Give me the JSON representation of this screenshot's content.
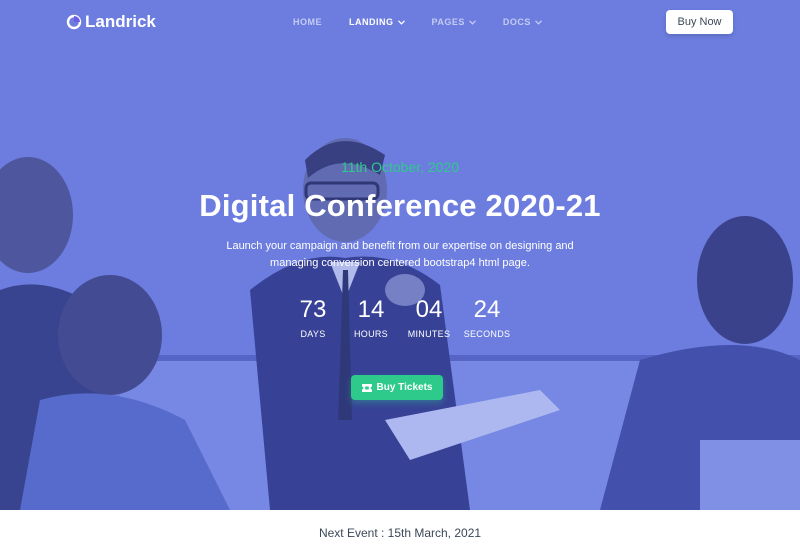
{
  "brand": {
    "name": "Landrick"
  },
  "nav": {
    "items": [
      {
        "label": "HOME",
        "has_dropdown": false,
        "active": false
      },
      {
        "label": "LANDING",
        "has_dropdown": true,
        "active": true
      },
      {
        "label": "PAGES",
        "has_dropdown": true,
        "active": false
      },
      {
        "label": "DOCS",
        "has_dropdown": true,
        "active": false
      }
    ],
    "cta_label": "Buy Now"
  },
  "hero": {
    "date": "11th October, 2020",
    "title": "Digital Conference 2020-21",
    "subtitle_line1": "Launch your campaign and benefit from our expertise on designing and",
    "subtitle_line2": "managing conversion centered bootstrap4 html page.",
    "countdown": [
      {
        "value": "73",
        "label": "DAYS"
      },
      {
        "value": "14",
        "label": "HOURS"
      },
      {
        "value": "04",
        "label": "MINUTES"
      },
      {
        "value": "24",
        "label": "SECONDS"
      }
    ],
    "button_label": "Buy Tickets",
    "button_icon": "ticket-icon"
  },
  "next_event": {
    "text": "Next Event : 15th March, 2021"
  },
  "colors": {
    "accent_green": "#2eca8b",
    "overlay_blue": "#6d80d8",
    "brand_blue": "#2f55d4",
    "text_dark": "#3c4858"
  }
}
